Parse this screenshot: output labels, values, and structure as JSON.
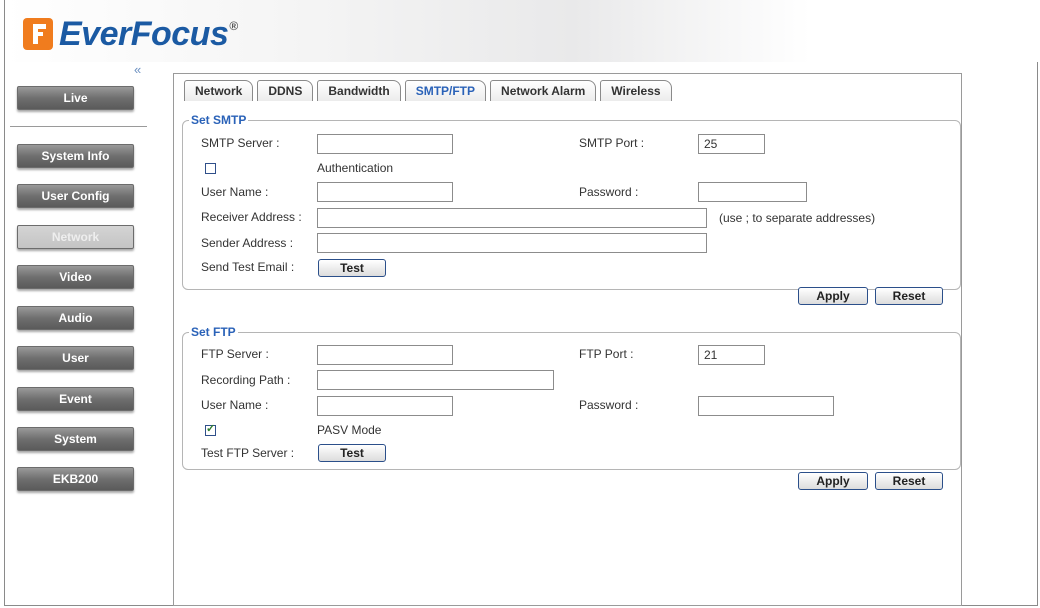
{
  "brand": {
    "name": "EverFocus",
    "trademark": "®"
  },
  "sidebar": {
    "collapse_glyph": "«",
    "items": [
      {
        "label": "Live"
      },
      {
        "label": "System Info"
      },
      {
        "label": "User Config"
      },
      {
        "label": "Network"
      },
      {
        "label": "Video"
      },
      {
        "label": "Audio"
      },
      {
        "label": "User"
      },
      {
        "label": "Event"
      },
      {
        "label": "System"
      },
      {
        "label": "EKB200"
      }
    ]
  },
  "tabs": [
    {
      "label": "Network"
    },
    {
      "label": "DDNS"
    },
    {
      "label": "Bandwidth"
    },
    {
      "label": "SMTP/FTP"
    },
    {
      "label": "Network Alarm"
    },
    {
      "label": "Wireless"
    }
  ],
  "smtp": {
    "legend": "Set SMTP",
    "server_label": "SMTP Server :",
    "server_value": "",
    "port_label": "SMTP Port :",
    "port_value": "25",
    "auth_label": "Authentication",
    "auth_checked": false,
    "username_label": "User Name :",
    "username_value": "",
    "password_label": "Password :",
    "password_value": "",
    "receiver_label": "Receiver Address :",
    "receiver_value": "",
    "receiver_hint": "(use ; to separate addresses)",
    "sender_label": "Sender Address :",
    "sender_value": "",
    "test_label": "Send Test Email :",
    "test_button": "Test",
    "apply_button": "Apply",
    "reset_button": "Reset"
  },
  "ftp": {
    "legend": "Set FTP",
    "server_label": "FTP Server :",
    "server_value": "",
    "port_label": "FTP Port :",
    "port_value": "21",
    "path_label": "Recording Path :",
    "path_value": "",
    "username_label": "User Name :",
    "username_value": "",
    "password_label": "Password :",
    "password_value": "",
    "pasv_label": "PASV Mode",
    "pasv_checked": true,
    "test_label": "Test FTP Server :",
    "test_button": "Test",
    "apply_button": "Apply",
    "reset_button": "Reset"
  },
  "colors": {
    "accent": "#2a62b8",
    "logo_orange": "#f07c1e",
    "logo_blue": "#1b5aa3"
  }
}
